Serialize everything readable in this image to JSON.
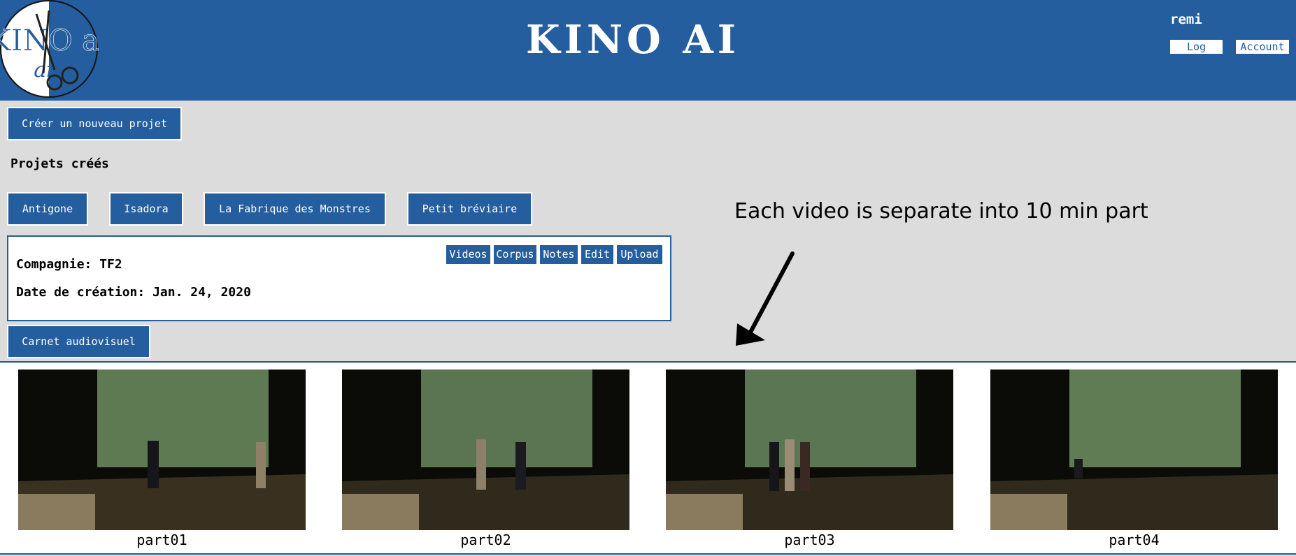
{
  "header": {
    "logo_text": "KINO ai",
    "title": "KINO AI",
    "username": "remi",
    "logout_label": "Log Out",
    "account_label": "Account"
  },
  "actions": {
    "new_project_label": "Créer un nouveau projet"
  },
  "projects": {
    "heading": "Projets créés",
    "items": [
      {
        "label": "Antigone"
      },
      {
        "label": "Isadora"
      },
      {
        "label": "La Fabrique des Monstres"
      },
      {
        "label": "Petit bréviaire"
      }
    ]
  },
  "project_card": {
    "company_line": "Compagnie: TF2",
    "date_line": "Date de création: Jan. 24, 2020",
    "buttons": [
      "Videos",
      "Corpus",
      "Notes",
      "Edit",
      "Upload"
    ]
  },
  "notebook_label": "Carnet audiovisuel",
  "annotation": "Each video is separate into 10 min part",
  "videos": [
    {
      "label": "part01"
    },
    {
      "label": "part02"
    },
    {
      "label": "part03"
    },
    {
      "label": "part04"
    }
  ],
  "colors": {
    "brand_blue": "#245e9e",
    "background": "#dcdcdc"
  }
}
